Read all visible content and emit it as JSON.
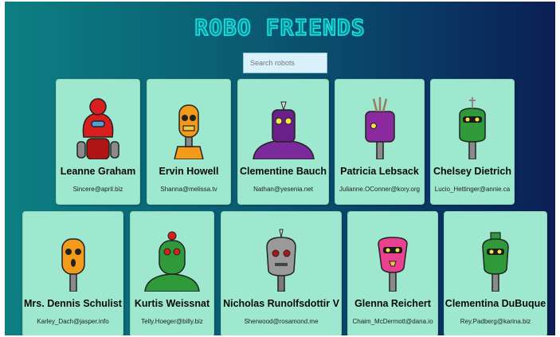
{
  "app": {
    "title": "ROBO FRIENDS",
    "search_placeholder": "Search robots"
  },
  "robots": [
    {
      "name": "Leanne Graham",
      "email": "Sincere@april.biz",
      "color": "#d81e1e",
      "icon": "red-robot-icon"
    },
    {
      "name": "Ervin Howell",
      "email": "Shanna@melissa.tv",
      "color": "#f39a1a",
      "icon": "orange-robot-icon"
    },
    {
      "name": "Clementine Bauch",
      "email": "Nathan@yesenia.net",
      "color": "#7a2a9a",
      "icon": "purple-robot-icon"
    },
    {
      "name": "Patricia Lebsack",
      "email": "Julianne.OConner@kory.org",
      "color": "#8a2a9e",
      "icon": "purple-robot-icon"
    },
    {
      "name": "Chelsey Dietrich",
      "email": "Lucio_Hettinger@annie.ca",
      "color": "#2f9a3a",
      "icon": "green-robot-icon"
    },
    {
      "name": "Mrs. Dennis Schulist",
      "email": "Karley_Dach@jasper.info",
      "color": "#f39a1a",
      "icon": "orange-robot-icon"
    },
    {
      "name": "Kurtis Weissnat",
      "email": "Telly.Hoeger@billy.biz",
      "color": "#2f9a3a",
      "icon": "green-robot-icon"
    },
    {
      "name": "Nicholas Runolfsdottir V",
      "email": "Sherwood@rosamond.me",
      "color": "#9a9a9a",
      "icon": "gray-robot-icon"
    },
    {
      "name": "Glenna Reichert",
      "email": "Chaim_McDermott@dana.io",
      "color": "#e8418f",
      "icon": "pink-robot-icon"
    },
    {
      "name": "Clementina DuBuque",
      "email": "Rey.Padberg@karina.biz",
      "color": "#2f9a3a",
      "icon": "green-robot-icon"
    }
  ]
}
